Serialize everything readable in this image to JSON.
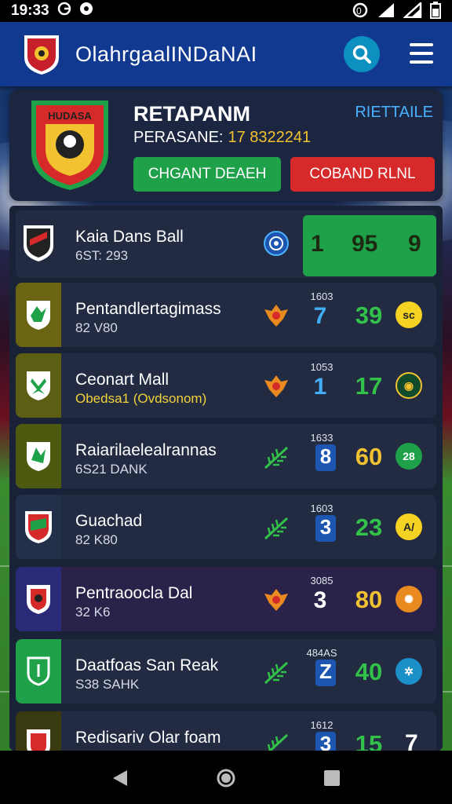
{
  "status_bar": {
    "time": "19:33",
    "icons": [
      "g-icon",
      "record-icon",
      "nfc-icon",
      "signal-icon",
      "wifi-icon",
      "battery-icon"
    ]
  },
  "app_bar": {
    "title": "OlahrgaalINDaNAI"
  },
  "team_card": {
    "name": "RETAPANM",
    "subtitle_label": "PERASANE:",
    "subtitle_value": "17 8322241",
    "link": "RIETTAILE",
    "crest_text": "HUDASA",
    "btn_primary": "CHGANT DEAEH",
    "btn_secondary": "COBAND RLNL"
  },
  "rows": [
    {
      "name": "Kaia Dans Ball",
      "sub": "6ST: 293",
      "tiny": "",
      "n1": "1",
      "n2": "95",
      "n3": "9",
      "crest_color": "#1a2238",
      "n1_color": "#222",
      "n2_color": "#222",
      "sub_color": "#d4dae6"
    },
    {
      "name": "Pentandlertagimass",
      "sub": "82 V80",
      "tiny": "1603",
      "n1": "7",
      "n2": "39",
      "badge": "sc",
      "crest_color": "#6a6413",
      "n1_color": "#41aef7",
      "n2_color": "#32c24a",
      "badge_color": "#f5d323",
      "sub_color": "#d4dae6"
    },
    {
      "name": "Ceonart Mall",
      "sub": "Obedsa1 (Ovdsonom)",
      "tiny": "1053",
      "n1": "1",
      "n2": "17",
      "badge": "◉",
      "crest_color": "#5c5e13",
      "n1_color": "#41aef7",
      "n2_color": "#32c24a",
      "badge_color": "#124a2c",
      "sub_color": "#f2d33a"
    },
    {
      "name": "Raiarilaelealrannas",
      "sub": "6S21 DANK",
      "tiny": "1633",
      "n1": "8",
      "n2": "60",
      "badge": "28",
      "crest_color": "#4e5a10",
      "n1_color": "#ffffff",
      "n2_color": "#f0c232",
      "badge_color": "#1fa14a",
      "sub_color": "#d4dae6"
    },
    {
      "name": "Guachad",
      "sub": "82 K80",
      "tiny": "1603",
      "n1": "3",
      "n2": "23",
      "badge": "A/",
      "crest_color": "#23304a",
      "n1_color": "#ffffff",
      "n2_color": "#32c24a",
      "badge_color": "#f5d323",
      "sub_color": "#d4dae6"
    },
    {
      "name": "Pentraoocla Dal",
      "sub": "32 K6",
      "tiny": "3085",
      "n1": "3",
      "n2": "80",
      "badge": "✺",
      "crest_color": "#2b2a78",
      "n1_color": "#ffffff",
      "n2_color": "#f0c232",
      "badge_color": "#e88a1f",
      "sub_color": "#d4dae6"
    },
    {
      "name": "Daatfoas San Reak",
      "sub": "S38 SAHK",
      "tiny": "484AS",
      "n1": "Z",
      "n2": "40",
      "badge": "✲",
      "crest_color": "#1fa14a",
      "n1_color": "#ffffff",
      "n2_color": "#32c24a",
      "badge_color": "#1b8fc8",
      "sub_color": "#d4dae6"
    },
    {
      "name": "Redisariv Olar foam",
      "sub": "",
      "tiny": "1612",
      "n1": "3",
      "n2": "15",
      "n3": "7",
      "crest_color": "#3a3a10",
      "n1_color": "#ffffff",
      "n2_color": "#32c24a",
      "sub_color": "#d4dae6"
    }
  ],
  "nav_bar": {
    "icons": [
      "back-icon",
      "home-icon",
      "recents-icon"
    ]
  }
}
